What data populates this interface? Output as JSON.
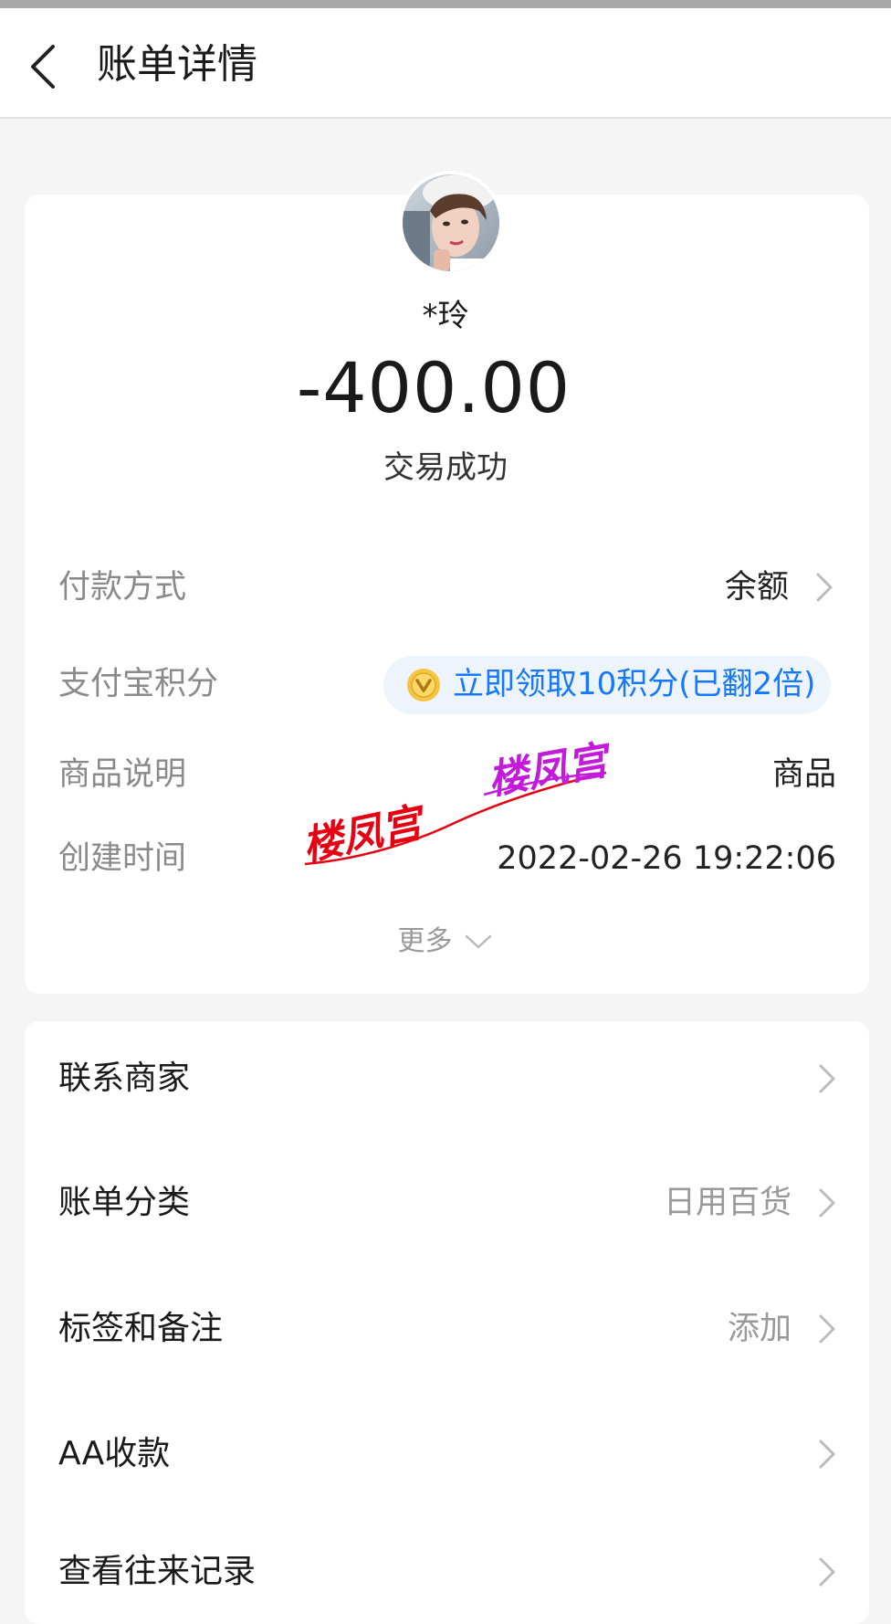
{
  "header": {
    "title": "账单详情"
  },
  "summary": {
    "payee": "*玲",
    "amount": "-400.00",
    "status": "交易成功"
  },
  "details": {
    "payment_method": {
      "label": "付款方式",
      "value": "余额"
    },
    "alipay_points": {
      "label": "支付宝积分",
      "action": "立即领取10积分(已翻2倍)"
    },
    "goods": {
      "label": "商品说明",
      "value": "商品"
    },
    "created": {
      "label": "创建时间",
      "value": "2022-02-26 19:22:06"
    },
    "more": "更多"
  },
  "watermark": {
    "text1": "楼凤宫",
    "text2": "楼凤宫"
  },
  "menu": {
    "items": [
      {
        "label": "联系商家",
        "value": ""
      },
      {
        "label": "账单分类",
        "value": "日用百货"
      },
      {
        "label": "标签和备注",
        "value": "添加"
      },
      {
        "label": "AA收款",
        "value": ""
      },
      {
        "label": "查看往来记录",
        "value": ""
      }
    ]
  },
  "colors": {
    "background": "#f5f5f5",
    "accent_blue": "#1677ff",
    "coin_gold": "#f5c542",
    "watermark_red": "#e60012",
    "watermark_purple": "#c21bd9"
  },
  "icons": {
    "back": "chevron-left-icon",
    "row_arrow": "chevron-right-icon",
    "more": "chevron-down-icon",
    "points": "coin-icon"
  }
}
